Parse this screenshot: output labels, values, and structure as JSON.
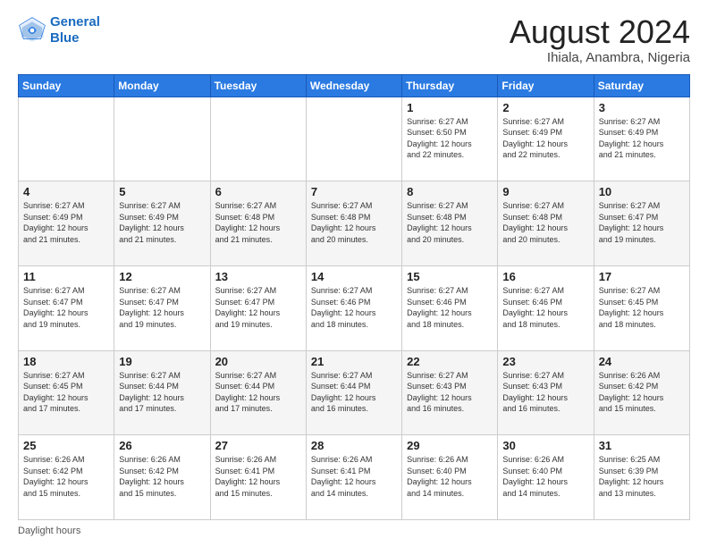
{
  "header": {
    "logo_line1": "General",
    "logo_line2": "Blue",
    "month_title": "August 2024",
    "location": "Ihiala, Anambra, Nigeria"
  },
  "days_of_week": [
    "Sunday",
    "Monday",
    "Tuesday",
    "Wednesday",
    "Thursday",
    "Friday",
    "Saturday"
  ],
  "weeks": [
    [
      {
        "day": "",
        "info": ""
      },
      {
        "day": "",
        "info": ""
      },
      {
        "day": "",
        "info": ""
      },
      {
        "day": "",
        "info": ""
      },
      {
        "day": "1",
        "info": "Sunrise: 6:27 AM\nSunset: 6:50 PM\nDaylight: 12 hours\nand 22 minutes."
      },
      {
        "day": "2",
        "info": "Sunrise: 6:27 AM\nSunset: 6:49 PM\nDaylight: 12 hours\nand 22 minutes."
      },
      {
        "day": "3",
        "info": "Sunrise: 6:27 AM\nSunset: 6:49 PM\nDaylight: 12 hours\nand 21 minutes."
      }
    ],
    [
      {
        "day": "4",
        "info": "Sunrise: 6:27 AM\nSunset: 6:49 PM\nDaylight: 12 hours\nand 21 minutes."
      },
      {
        "day": "5",
        "info": "Sunrise: 6:27 AM\nSunset: 6:49 PM\nDaylight: 12 hours\nand 21 minutes."
      },
      {
        "day": "6",
        "info": "Sunrise: 6:27 AM\nSunset: 6:48 PM\nDaylight: 12 hours\nand 21 minutes."
      },
      {
        "day": "7",
        "info": "Sunrise: 6:27 AM\nSunset: 6:48 PM\nDaylight: 12 hours\nand 20 minutes."
      },
      {
        "day": "8",
        "info": "Sunrise: 6:27 AM\nSunset: 6:48 PM\nDaylight: 12 hours\nand 20 minutes."
      },
      {
        "day": "9",
        "info": "Sunrise: 6:27 AM\nSunset: 6:48 PM\nDaylight: 12 hours\nand 20 minutes."
      },
      {
        "day": "10",
        "info": "Sunrise: 6:27 AM\nSunset: 6:47 PM\nDaylight: 12 hours\nand 19 minutes."
      }
    ],
    [
      {
        "day": "11",
        "info": "Sunrise: 6:27 AM\nSunset: 6:47 PM\nDaylight: 12 hours\nand 19 minutes."
      },
      {
        "day": "12",
        "info": "Sunrise: 6:27 AM\nSunset: 6:47 PM\nDaylight: 12 hours\nand 19 minutes."
      },
      {
        "day": "13",
        "info": "Sunrise: 6:27 AM\nSunset: 6:47 PM\nDaylight: 12 hours\nand 19 minutes."
      },
      {
        "day": "14",
        "info": "Sunrise: 6:27 AM\nSunset: 6:46 PM\nDaylight: 12 hours\nand 18 minutes."
      },
      {
        "day": "15",
        "info": "Sunrise: 6:27 AM\nSunset: 6:46 PM\nDaylight: 12 hours\nand 18 minutes."
      },
      {
        "day": "16",
        "info": "Sunrise: 6:27 AM\nSunset: 6:46 PM\nDaylight: 12 hours\nand 18 minutes."
      },
      {
        "day": "17",
        "info": "Sunrise: 6:27 AM\nSunset: 6:45 PM\nDaylight: 12 hours\nand 18 minutes."
      }
    ],
    [
      {
        "day": "18",
        "info": "Sunrise: 6:27 AM\nSunset: 6:45 PM\nDaylight: 12 hours\nand 17 minutes."
      },
      {
        "day": "19",
        "info": "Sunrise: 6:27 AM\nSunset: 6:44 PM\nDaylight: 12 hours\nand 17 minutes."
      },
      {
        "day": "20",
        "info": "Sunrise: 6:27 AM\nSunset: 6:44 PM\nDaylight: 12 hours\nand 17 minutes."
      },
      {
        "day": "21",
        "info": "Sunrise: 6:27 AM\nSunset: 6:44 PM\nDaylight: 12 hours\nand 16 minutes."
      },
      {
        "day": "22",
        "info": "Sunrise: 6:27 AM\nSunset: 6:43 PM\nDaylight: 12 hours\nand 16 minutes."
      },
      {
        "day": "23",
        "info": "Sunrise: 6:27 AM\nSunset: 6:43 PM\nDaylight: 12 hours\nand 16 minutes."
      },
      {
        "day": "24",
        "info": "Sunrise: 6:26 AM\nSunset: 6:42 PM\nDaylight: 12 hours\nand 15 minutes."
      }
    ],
    [
      {
        "day": "25",
        "info": "Sunrise: 6:26 AM\nSunset: 6:42 PM\nDaylight: 12 hours\nand 15 minutes."
      },
      {
        "day": "26",
        "info": "Sunrise: 6:26 AM\nSunset: 6:42 PM\nDaylight: 12 hours\nand 15 minutes."
      },
      {
        "day": "27",
        "info": "Sunrise: 6:26 AM\nSunset: 6:41 PM\nDaylight: 12 hours\nand 15 minutes."
      },
      {
        "day": "28",
        "info": "Sunrise: 6:26 AM\nSunset: 6:41 PM\nDaylight: 12 hours\nand 14 minutes."
      },
      {
        "day": "29",
        "info": "Sunrise: 6:26 AM\nSunset: 6:40 PM\nDaylight: 12 hours\nand 14 minutes."
      },
      {
        "day": "30",
        "info": "Sunrise: 6:26 AM\nSunset: 6:40 PM\nDaylight: 12 hours\nand 14 minutes."
      },
      {
        "day": "31",
        "info": "Sunrise: 6:25 AM\nSunset: 6:39 PM\nDaylight: 12 hours\nand 13 minutes."
      }
    ]
  ],
  "footer": {
    "label": "Daylight hours"
  }
}
